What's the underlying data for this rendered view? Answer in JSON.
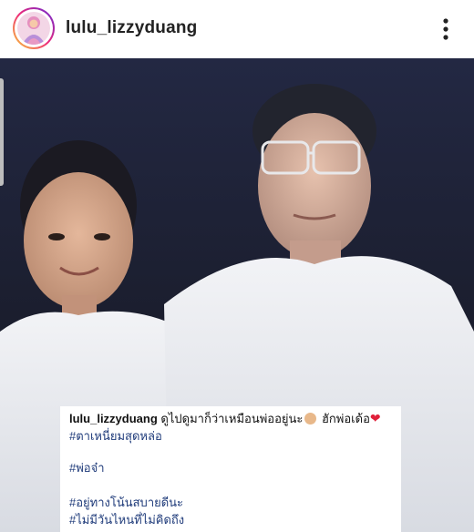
{
  "post": {
    "username": "lulu_lizzyduang",
    "avatar_icon": "profile-photo-avatar",
    "more_icon": "vertical-ellipsis-icon"
  },
  "photo": {
    "description_icon": "old-photo-two-people"
  },
  "caption": {
    "username": "lulu_lizzyduang",
    "text_part1": "ดูไปดูมาก็ว่าเหมือนพ่ออยู่นะ",
    "text_part2": " ฮักพ่อเด้อ",
    "emoji1": "face-emoji",
    "emoji2": "red-heart-emoji",
    "hashtags": [
      "#ตาเหนี่ยมสุดหล่อ",
      "#พ่อจ๋า",
      "#อยู่ทางโน้นสบายดีนะ",
      "#ไม่มีวันไหนที่ไม่คิดถึง"
    ]
  },
  "colors": {
    "hashtag": "#1f3b7a",
    "heart": "#e0203a",
    "background_dark": "#1e2236"
  }
}
